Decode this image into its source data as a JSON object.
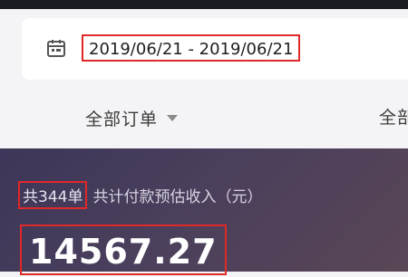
{
  "date_range": "2019/06/21 - 2019/06/21",
  "icons": {
    "calendar": "calendar-icon",
    "dropdown": "caret-down-icon"
  },
  "filters": {
    "order_filter": "全部订单",
    "second_filter": "全部"
  },
  "stats": {
    "order_count": "共344单",
    "estimate_label": "共计付款预估收入（元）",
    "amount": "14567.27"
  },
  "colors": {
    "highlight_box": "#e12828",
    "stats_background": "#453c5b",
    "card": "#ffffff"
  }
}
